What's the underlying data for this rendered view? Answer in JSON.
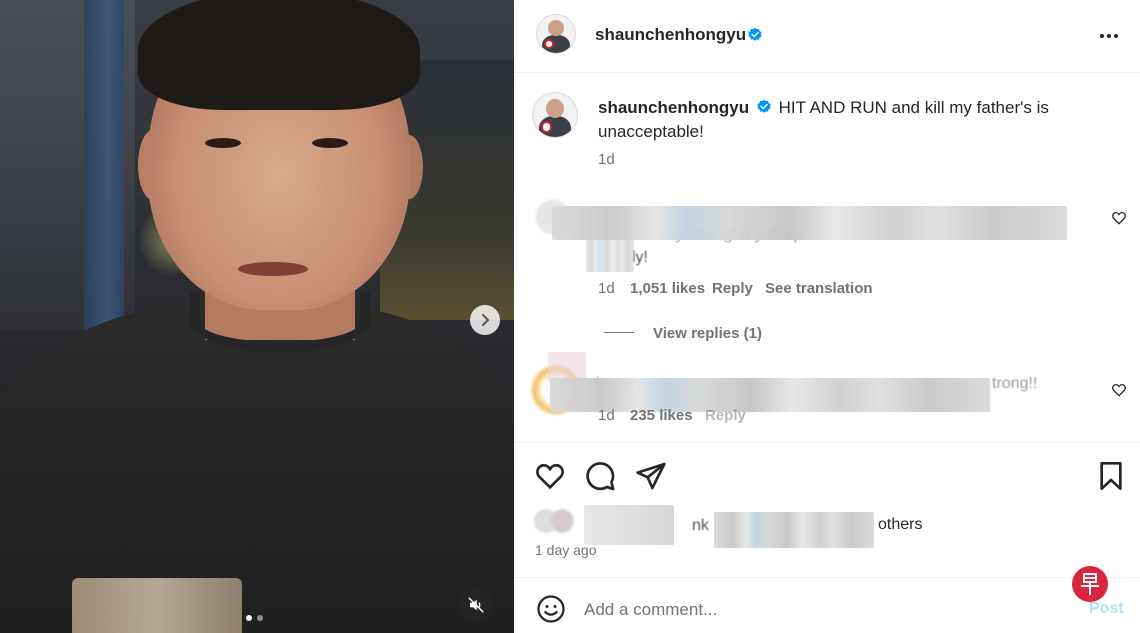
{
  "post": {
    "username": "shaunchenhongyu",
    "caption_username": "shaunchenhongyu",
    "caption": "HIT AND RUN and kill my father's is unacceptable!",
    "caption_time": "1d"
  },
  "media": {
    "slide_count": 2,
    "active_slide": 1,
    "next_icon": "chevron-right-icon",
    "mute_icon": "speaker-muted-icon"
  },
  "comments": [
    {
      "blurred_fragment_1": "tay strong!  my deep",
      "blurred_fragment_2": "ly!",
      "time": "1d",
      "likes": "1,051 likes",
      "reply": "Reply",
      "translate": "See translation",
      "view_replies": "View replies (1)"
    },
    {
      "blurred_fragment_1": "jeremy",
      "blurred_fragment_2": "trong!!",
      "time": "1d",
      "likes": "235 likes",
      "reply": "Reply"
    }
  ],
  "likes_summary": {
    "blurred_fragment_1": "nk",
    "blurred_fragment_2": "others",
    "time": "1 day ago"
  },
  "composer": {
    "placeholder": "Add a comment...",
    "post_label": "Post"
  },
  "colors": {
    "verified_blue": "#0095f6",
    "post_disabled": "#b2dffc",
    "watermark_red": "#d7263d"
  },
  "watermark_glyph": "早"
}
